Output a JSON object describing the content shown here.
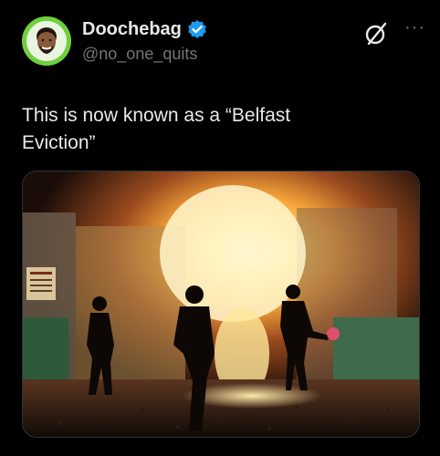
{
  "author": {
    "display_name": "Doochebag",
    "handle": "@no_one_quits",
    "verified": true,
    "avatar_icon": "avatar-face-icon"
  },
  "header": {
    "platform_icon": "x-logo-icon",
    "more_label": "···"
  },
  "tweet": {
    "text_line1": "This is now known as a “Belfast",
    "text_line2": "Eviction”"
  },
  "media": {
    "description_icon": "photo",
    "sign_text": "DO NOT ENTER"
  },
  "colors": {
    "background": "#000000",
    "text": "#e7e9ea",
    "muted": "#71767b",
    "verified": "#1d9bf0"
  }
}
